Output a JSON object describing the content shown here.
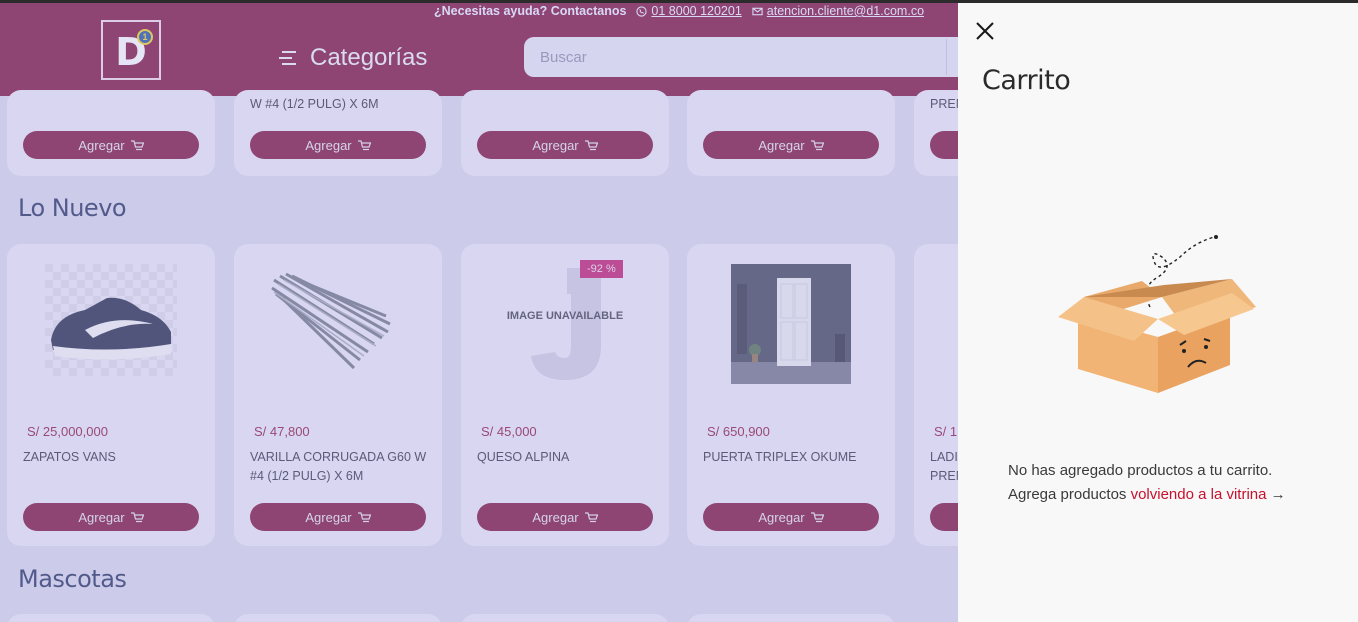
{
  "header": {
    "help_label": "¿Necesitas ayuda? Contactanos",
    "phone": "01 8000 120201",
    "email": "atencion.cliente@d1.com.co",
    "logo_text": "D",
    "logo_badge": "1",
    "categories_label": "Categorías",
    "search_placeholder": "Buscar"
  },
  "top_row": {
    "cards": [
      {
        "name_partial": "",
        "button": "Agregar"
      },
      {
        "name_partial": "W #4 (1/2 PULG) X 6M",
        "button": "Agregar"
      },
      {
        "name_partial": "",
        "button": "Agregar"
      },
      {
        "name_partial": "",
        "button": "Agregar"
      },
      {
        "name_partial": "PREM",
        "button": "Agregar"
      }
    ]
  },
  "sections": {
    "new": {
      "title": "Lo Nuevo",
      "products": [
        {
          "price": "S/ 25,000,000",
          "name": "ZAPATOS VANS",
          "button": "Agregar"
        },
        {
          "price": "S/ 47,800",
          "name": "VARILLA CORRUGADA G60 W #4 (1/2 PULG) X 6M",
          "button": "Agregar"
        },
        {
          "price": "S/ 45,000",
          "name": "QUESO ALPINA",
          "button": "Agregar",
          "discount": "-92 %",
          "image_text": "IMAGE UNAVAILABLE"
        },
        {
          "price": "S/ 650,900",
          "name": "PUERTA TRIPLEX OKUME",
          "button": "Agregar"
        },
        {
          "price": "S/ 1",
          "name": "LADI PREM",
          "button": "Agregar"
        }
      ]
    },
    "pets": {
      "title": "Mascotas"
    }
  },
  "cart": {
    "title": "Carrito",
    "empty_line1": "No has agregado productos a tu carrito.",
    "empty_line2_prefix": "Agrega productos ",
    "empty_line2_link": "volviendo a la vitrina",
    "arrow": "→"
  },
  "colors": {
    "brand": "#7a0a37",
    "accent_link": "#c8102e",
    "discount": "#c0156a"
  }
}
